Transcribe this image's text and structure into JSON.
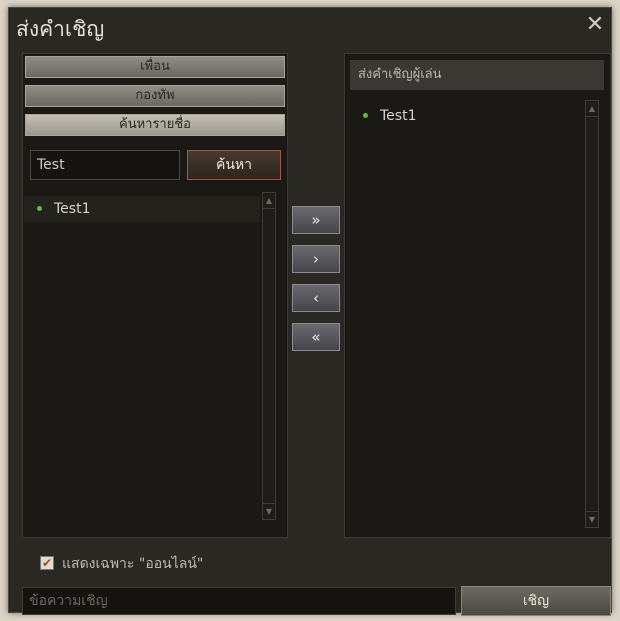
{
  "window": {
    "title": "ส่งคำเชิญ",
    "close_glyph": "✕"
  },
  "tabs": [
    {
      "label": "เพื่อน"
    },
    {
      "label": "กองทัพ"
    },
    {
      "label": "ค้นหารายชื่อ"
    }
  ],
  "search": {
    "value": "Test",
    "button_label": "ค้นหา"
  },
  "left_list": {
    "items": [
      {
        "name": "Test1",
        "status": "online"
      }
    ]
  },
  "right_panel": {
    "header": "ส่งคำเชิญผู้เล่น",
    "items": [
      {
        "name": "Test1",
        "status": "online"
      }
    ]
  },
  "move_buttons": {
    "add_all": "»",
    "add": "›",
    "remove": "‹",
    "remove_all": "«"
  },
  "online_filter": {
    "checked": true,
    "label": "แสดงเฉพาะ \"ออนไลน์\""
  },
  "message": {
    "placeholder": "ข้อความเชิญ"
  },
  "invite_button": {
    "label": "เชิญ"
  },
  "colors": {
    "online_dot": "#5dbf3a",
    "accent_border": "#9a5c3c"
  }
}
